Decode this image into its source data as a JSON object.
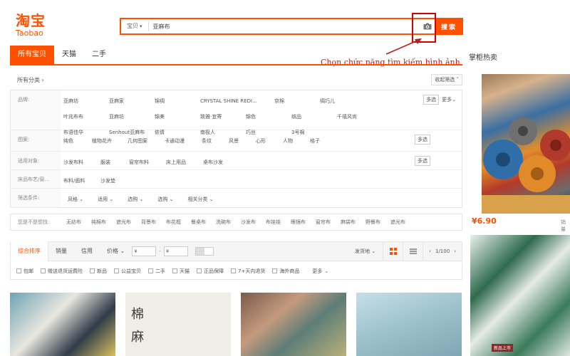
{
  "header": {
    "logo_cn": "淘宝",
    "logo_en": "Taobao",
    "search_category": "宝贝",
    "search_query": "亚麻布",
    "search_button": "搜索"
  },
  "annotation": "Chọn chức năng tìm kiếm hình ảnh",
  "tabs": [
    "所有宝贝",
    "天猫",
    "二手"
  ],
  "crumb": "所有分类",
  "collapse": "收起筛选",
  "filters": {
    "brand": {
      "label": "品牌:",
      "values": [
        "亚麻坊",
        "亚麻家",
        "锦绸",
        "CRYSTAL SHINE REDI...",
        "京棉",
        "绸巧儿",
        "叶兆布布",
        "亚麻坊",
        "锦美",
        "致雅·宜寄",
        "锦色",
        "缤品",
        "千禧风尚",
        "布语佳华",
        "Senhout亚麻布",
        "依倩",
        "南极人",
        "巧丝",
        "3号棉"
      ]
    },
    "pattern": {
      "label": "图案:",
      "values": [
        "纯色",
        "植物花卉",
        "几何图案",
        "卡通动漫",
        "条纹",
        "风景",
        "心形",
        "人物",
        "格子"
      ]
    },
    "usage": {
      "label": "适用对象:",
      "values": [
        "沙发布料",
        "服装",
        "窗帘布料",
        "床上用品",
        "桌布沙发"
      ]
    },
    "craft": {
      "label": "床品布艺/窗...",
      "values": [
        "布料/面料",
        "沙发垫"
      ]
    },
    "conditions": {
      "label": "筛选条件:",
      "values": [
        "风格",
        "适用",
        "选购",
        "选购",
        "相关分类"
      ]
    },
    "multi": "多选",
    "more": "更多"
  },
  "guess": {
    "label": "您是不是想找:",
    "items": [
      "无纺布",
      "纯棉布",
      "遮光布",
      "背景布",
      "布花框",
      "餐桌布",
      "洗碗布",
      "沙发布",
      "布娃娃",
      "眼镜布",
      "窗帘布",
      "麻袋布",
      "野餐布",
      "遮光布"
    ]
  },
  "sortbar": {
    "sorts": [
      "综合排序",
      "销量",
      "信用",
      "价格"
    ],
    "price_from": "¥",
    "price_to": "¥",
    "dash": "-",
    "ship": "发货地",
    "page": "1/100"
  },
  "checks": [
    "包邮",
    "赠送退货运费险",
    "新品",
    "公益宝贝",
    "二手",
    "天猫",
    "正品保障",
    "7+天内退货",
    "海外商品",
    "更多"
  ],
  "product_chars": [
    "棉",
    "麻"
  ],
  "sidebar": {
    "title": "掌柜热卖",
    "price": "¥6.90",
    "sales": "销量",
    "tag": "新品上市"
  }
}
